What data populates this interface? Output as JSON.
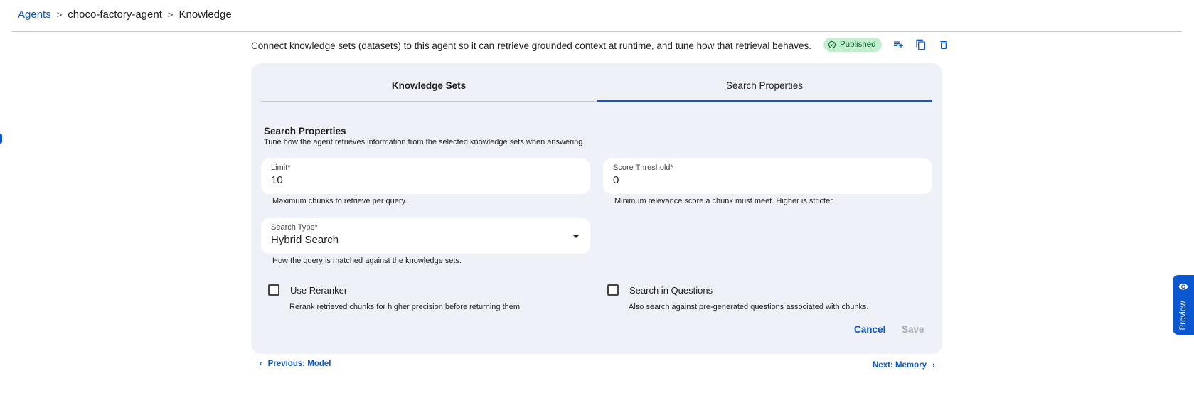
{
  "breadcrumb": {
    "root": "Agents",
    "separator": ">",
    "agent": "choco-factory-agent",
    "current": "Knowledge"
  },
  "header": {
    "description": "Connect knowledge sets (datasets) to this agent so it can retrieve grounded context at runtime, and tune how that retrieval behaves.",
    "status": "Published",
    "icons": [
      "playlist-add-icon",
      "copy-icon",
      "delete-icon"
    ]
  },
  "tabs": [
    {
      "label": "Knowledge Sets",
      "active": false
    },
    {
      "label": "Search Properties",
      "active": true
    }
  ],
  "section": {
    "title": "Search Properties",
    "subtitle": "Tune how the agent retrieves information from the selected knowledge sets when answering."
  },
  "fields": {
    "limit": {
      "label": "Limit*",
      "value": "10",
      "helper": "Maximum chunks to retrieve per query."
    },
    "score_threshold": {
      "label": "Score Threshold*",
      "value": "0",
      "helper": "Minimum relevance score a chunk must meet. Higher is stricter."
    },
    "search_type": {
      "label": "Search Type*",
      "value": "Hybrid Search",
      "helper": "How the query is matched against the knowledge sets."
    }
  },
  "checkboxes": {
    "use_reranker": {
      "label": "Use Reranker",
      "checked": false,
      "helper": "Rerank retrieved chunks for higher precision before returning them."
    },
    "search_in_questions": {
      "label": "Search in Questions",
      "checked": false,
      "helper": "Also search against pre-generated questions associated with chunks."
    }
  },
  "actions": {
    "cancel": "Cancel",
    "save": "Save"
  },
  "navigation": {
    "previous": "Previous: Model",
    "next": "Next: Memory"
  },
  "preview": {
    "label": "Preview"
  },
  "colors": {
    "accent": "#0b57d0",
    "card_bg": "#eef2f8",
    "badge_bg": "#c4eed0",
    "badge_text": "#0d652d"
  }
}
